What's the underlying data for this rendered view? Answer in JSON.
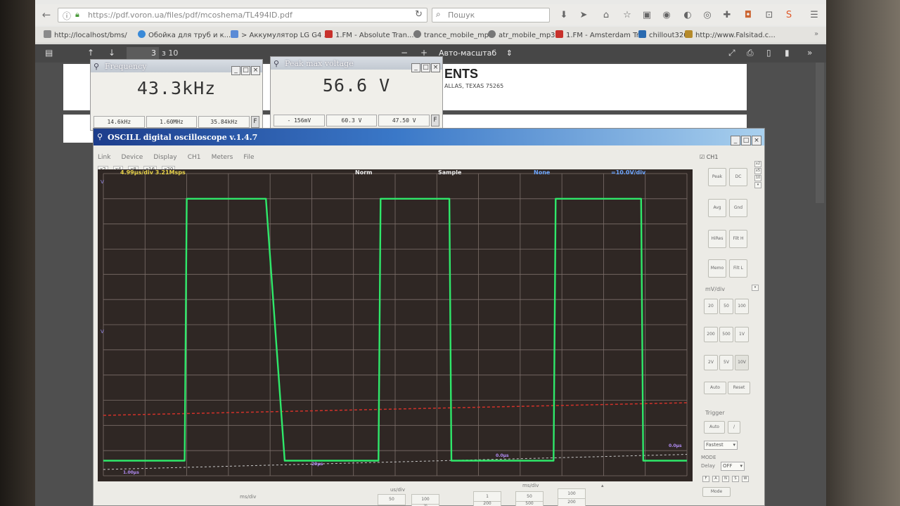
{
  "browser": {
    "url": "https://pdf.voron.ua/files/pdf/mcoshema/TL494ID.pdf",
    "search_placeholder": "Пошук",
    "bookmarks": [
      {
        "label": "http://localhost/bms/",
        "color": "#8a8a8a"
      },
      {
        "label": "Обойка для труб и к...",
        "color": "#3a8ad8"
      },
      {
        "label": "> Аккумулятор LG G4 ...",
        "color": "#5b8bd6"
      },
      {
        "label": "1.FM - Absolute Tran...",
        "color": "#c8312b"
      },
      {
        "label": "trance_mobile_mp3",
        "color": "#777"
      },
      {
        "label": "atr_mobile_mp3",
        "color": "#777"
      },
      {
        "label": "1.FM - Amsterdam Tr...",
        "color": "#c8312b"
      },
      {
        "label": "chillout320",
        "color": "#2a6ab0"
      },
      {
        "label": "http://www.Falsitad.c...",
        "color": "#b58a2a"
      }
    ]
  },
  "pdf": {
    "page_current": "3",
    "page_total": "з 10",
    "zoom": "Авто-масштаб",
    "heading": "ENTS",
    "address": "ALLAS, TEXAS 75265"
  },
  "frequency_meter": {
    "title": "Frequency",
    "value": "43.3kHz",
    "sub": [
      "14.6kHz",
      "1.60MHz",
      "35.84kHz"
    ]
  },
  "voltage_meter": {
    "title": "Peak max voltage",
    "value": "56.6 V",
    "sub": [
      "- 156mV",
      "60.3 V",
      "47.50 V"
    ]
  },
  "oscilloscope": {
    "title": "OSCILL digital oscilloscope  v.1.4.7",
    "menu": [
      "Link",
      "Device",
      "Display",
      "CH1",
      "Meters",
      "File"
    ],
    "zoom_buttons": [
      "x2",
      "x4",
      "x8",
      "x16",
      "x20"
    ],
    "timebase_info": "4.99µs/div  3.21Msps",
    "trigger_mode": "Norm",
    "acq_mode": "Sample",
    "ch_coupling": "None",
    "volts_div": "=10.0V/div",
    "bottom_left_time": "1.00µs",
    "marker_1": "20µs",
    "marker_2": "0.0µs",
    "marker_right": "0.0µs",
    "channel_label": "CH1",
    "ch_buttons": [
      "Peak",
      "DC",
      "Avg",
      "Gnd",
      "HiRes",
      "Filt H",
      "Memo",
      "Filt L"
    ],
    "mv_div_label": "mV/div",
    "mv_buttons": [
      "20",
      "50",
      "100",
      "200",
      "500",
      "1V",
      "2V",
      "5V",
      "10V"
    ],
    "auto_buttons": [
      "Auto",
      "Reset"
    ],
    "trigger_label": "Trigger",
    "trigger_auto": "Auto",
    "fastest": "Fastest",
    "mode_label": "MODE",
    "delay_label": "Delay",
    "delay_value": "OFF",
    "mode_button": "Mode",
    "bottom_labels": [
      "ms/div",
      "us/div",
      "ms/div"
    ],
    "bottom_values": [
      "50",
      "100",
      "1",
      "50",
      "100",
      "200",
      "500",
      "20",
      "200"
    ]
  },
  "chart_data": {
    "type": "line",
    "series": [
      {
        "name": "CH1",
        "color": "#2fe86a",
        "values": [
          [
            0,
            0.6
          ],
          [
            1.95,
            0.6
          ],
          [
            2.0,
            11.0
          ],
          [
            3.9,
            11.0
          ],
          [
            4.35,
            0.6
          ],
          [
            6.6,
            0.6
          ],
          [
            6.65,
            11.0
          ],
          [
            8.3,
            11.0
          ],
          [
            8.35,
            0.6
          ],
          [
            10.8,
            0.6
          ],
          [
            10.85,
            11.0
          ],
          [
            12.9,
            11.0
          ],
          [
            12.95,
            0.6
          ],
          [
            14.0,
            0.6
          ]
        ]
      }
    ],
    "trigger_level_color": "#d2322a",
    "ground_color": "#c8c8c8"
  }
}
